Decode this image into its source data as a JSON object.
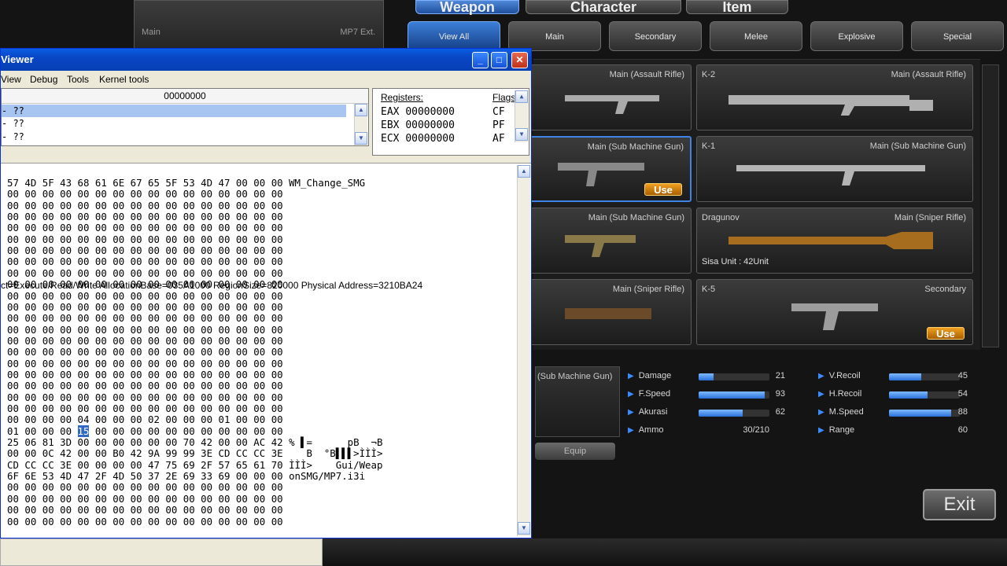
{
  "game": {
    "top_strip": {
      "left_label": "Main",
      "right_label": "MP7 Ext."
    },
    "top_tabs": [
      "Weapon",
      "Character",
      "Item"
    ],
    "sub_tabs": [
      "View All",
      "Main",
      "Secondary",
      "Melee",
      "Explosive",
      "Special"
    ],
    "cards": [
      {
        "name": "",
        "type": "Main (Assault Rifle)",
        "extra": "",
        "use": ""
      },
      {
        "name": "K-2",
        "type": "Main (Assault Rifle)",
        "extra": "",
        "use": ""
      },
      {
        "name": "",
        "type": "Main (Sub Machine Gun)",
        "extra": "",
        "use": "Use"
      },
      {
        "name": "K-1",
        "type": "Main (Sub Machine Gun)",
        "extra": "",
        "use": ""
      },
      {
        "name": "",
        "type": "Main (Sub Machine Gun)",
        "extra": "",
        "use": ""
      },
      {
        "name": "Dragunov",
        "type": "Main (Sniper Rifle)",
        "extra": "Sisa Unit : 42Unit",
        "use": ""
      },
      {
        "name": "",
        "type": "Main (Sniper Rifle)",
        "extra": "",
        "use": ""
      },
      {
        "name": "K-5",
        "type": "Secondary",
        "extra": "",
        "use": "Use"
      }
    ],
    "selected_weapon_type": "(Sub Machine Gun)",
    "stats": {
      "damage": {
        "label": "Damage",
        "value": "21",
        "level": 0.21
      },
      "fspeed": {
        "label": "F.Speed",
        "value": "93",
        "level": 0.93
      },
      "akurasi": {
        "label": "Akurasi",
        "value": "62",
        "level": 0.62
      },
      "ammo": {
        "label": "Ammo",
        "value": "30/210"
      },
      "vrecoil": {
        "label": "V.Recoil",
        "value": "45",
        "level": 0.45
      },
      "hrecoil": {
        "label": "H.Recoil",
        "value": "54",
        "level": 0.54
      },
      "mspeed": {
        "label": "M.Speed",
        "value": "88",
        "level": 0.88
      },
      "range": {
        "label": "Range",
        "value": "60"
      }
    },
    "equip_label": "Equip",
    "exit_label": "Exit"
  },
  "debugger": {
    "title": "Viewer",
    "menu": [
      "View",
      "Debug",
      "Tools",
      "Kernel tools"
    ],
    "disasm_header": "00000000",
    "disasm_rows": [
      "- ??",
      "- ??",
      "- ??",
      "- ??"
    ],
    "registers_label": "Registers:",
    "flags_label": "Flags",
    "registers": [
      {
        "name": "EAX",
        "value": "00000000",
        "flag": "CF"
      },
      {
        "name": "EBX",
        "value": "00000000",
        "flag": "PF"
      },
      {
        "name": "ECX",
        "value": "00000000",
        "flag": "AF"
      }
    ],
    "status": "ct=Execute/Read/Write  AllocationBase=035A1000 RegionSize=820000 Physical Address=3210BA24",
    "hex_lines": [
      "57 4D 5F 43 68 61 6E 67 65 5F 53 4D 47 00 00 00 WM_Change_SMG",
      "00 00 00 00 00 00 00 00 00 00 00 00 00 00 00 00",
      "00 00 00 00 00 00 00 00 00 00 00 00 00 00 00 00",
      "00 00 00 00 00 00 00 00 00 00 00 00 00 00 00 00",
      "00 00 00 00 00 00 00 00 00 00 00 00 00 00 00 00",
      "00 00 00 00 00 00 00 00 00 00 00 00 00 00 00 00",
      "00 00 00 00 00 00 00 00 00 00 00 00 00 00 00 00",
      "00 00 00 00 00 00 00 00 00 00 00 00 00 00 00 00",
      "00 00 00 00 00 00 00 00 00 00 00 00 00 00 00 00",
      "00 00 00 00 00 00 00 00 00 00 00 00 00 00 00 00",
      "00 00 00 00 00 00 00 00 00 00 00 00 00 00 00 00",
      "00 00 00 00 00 00 00 00 00 00 00 00 00 00 00 00",
      "00 00 00 00 00 00 00 00 00 00 00 00 00 00 00 00",
      "00 00 00 00 00 00 00 00 00 00 00 00 00 00 00 00",
      "00 00 00 00 00 00 00 00 00 00 00 00 00 00 00 00",
      "00 00 00 00 00 00 00 00 00 00 00 00 00 00 00 00",
      "00 00 00 00 00 00 00 00 00 00 00 00 00 00 00 00",
      "00 00 00 00 00 00 00 00 00 00 00 00 00 00 00 00",
      "00 00 00 00 00 00 00 00 00 00 00 00 00 00 00 00",
      "00 00 00 00 00 00 00 00 00 00 00 00 00 00 00 00",
      "00 00 00 00 00 00 00 00 00 00 00 00 00 00 00 00",
      "00 00 00 00 04 00 00 00 02 00 00 00 01 00 00 00",
      "01 00 00 00 ",
      "25 06 81 3D 00 00 00 00 00 00 70 42 00 00 AC 42 % ▌=      pB  ¬B",
      "00 00 0C 42 00 00 B0 42 9A 99 99 3E CD CC CC 3E    B  °B▌▌▌>ÌÌÌ>",
      "CD CC CC 3E 00 00 00 00 47 75 69 2F 57 65 61 70 ÌÌÌ>    Gui/Weap",
      "6F 6E 53 4D 47 2F 4D 50 37 2E 69 33 69 00 00 00 onSMG/MP7.i3i",
      "00 00 00 00 00 00 00 00 00 00 00 00 00 00 00 00",
      "00 00 00 00 00 00 00 00 00 00 00 00 00 00 00 00",
      "00 00 00 00 00 00 00 00 00 00 00 00 00 00 00 00",
      "00 00 00 00 00 00 00 00 00 00 00 00 00 00 00 00"
    ],
    "hex_highlight": "15",
    "hex_after_highlight": " 00 00 00 00 00 00 00 00 00 00 00"
  }
}
